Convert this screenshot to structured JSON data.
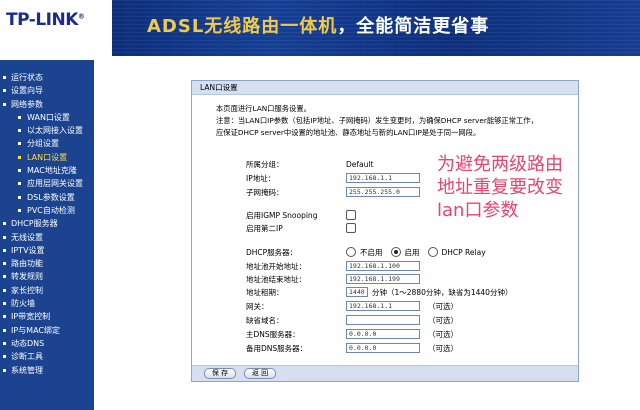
{
  "header": {
    "logo": "TP-LINK",
    "logo_mark": "®",
    "slogan_colored": "ADSL无线路由一体机",
    "slogan_white": "，全能简洁更省事"
  },
  "sidebar": {
    "items": [
      {
        "label": "运行状态",
        "level": 0,
        "active": false
      },
      {
        "label": "设置向导",
        "level": 0,
        "active": false
      },
      {
        "label": "网络参数",
        "level": 0,
        "active": false
      },
      {
        "label": "WAN口设置",
        "level": 1,
        "active": false
      },
      {
        "label": "以太网接入设置",
        "level": 1,
        "active": false
      },
      {
        "label": "分组设置",
        "level": 1,
        "active": false
      },
      {
        "label": "LAN口设置",
        "level": 1,
        "active": true
      },
      {
        "label": "MAC地址克隆",
        "level": 1,
        "active": false
      },
      {
        "label": "应用层网关设置",
        "level": 1,
        "active": false
      },
      {
        "label": "DSL参数设置",
        "level": 1,
        "active": false
      },
      {
        "label": "PVC自动检测",
        "level": 1,
        "active": false
      },
      {
        "label": "DHCP服务器",
        "level": 0,
        "active": false
      },
      {
        "label": "无线设置",
        "level": 0,
        "active": false
      },
      {
        "label": "IPTV设置",
        "level": 0,
        "active": false
      },
      {
        "label": "路由功能",
        "level": 0,
        "active": false
      },
      {
        "label": "转发规则",
        "level": 0,
        "active": false
      },
      {
        "label": "家长控制",
        "level": 0,
        "active": false
      },
      {
        "label": "防火墙",
        "level": 0,
        "active": false
      },
      {
        "label": "IP带宽控制",
        "level": 0,
        "active": false
      },
      {
        "label": "IP与MAC绑定",
        "level": 0,
        "active": false
      },
      {
        "label": "动态DNS",
        "level": 0,
        "active": false
      },
      {
        "label": "诊断工具",
        "level": 0,
        "active": false
      },
      {
        "label": "系统管理",
        "level": 0,
        "active": false
      }
    ]
  },
  "panel": {
    "title": "LAN口设置",
    "intro": "本页面进行LAN口服务设置。",
    "note_line1": "注意：当LAN口IP参数（包括IP地址、子网掩码）发生变更时，为确保DHCP server能够正常工作，",
    "note_line2": "应保证DHCP server中设置的地址池、静态地址与新的LAN口IP是处于同一网段。",
    "group_label": "所属分组：",
    "group_value": "Default",
    "ip_label": "IP地址：",
    "ip_value": "192.168.1.1",
    "mask_label": "子网掩码：",
    "mask_value": "255.255.255.0",
    "igmp_label": "启用IGMP Snooping",
    "second_ip_label": "启用第二IP",
    "dhcp_label": "DHCP服务器：",
    "dhcp_opt_off": "不启用",
    "dhcp_opt_on": "启用",
    "dhcp_opt_relay": "DHCP Relay",
    "dhcp_selected": "启用",
    "pool_start_label": "地址池开始地址：",
    "pool_start_value": "192.168.1.100",
    "pool_end_label": "地址池结束地址：",
    "pool_end_value": "192.168.1.199",
    "lease_label": "地址租期：",
    "lease_value": "1440",
    "lease_hint": "分钟（1～2880分钟，缺省为1440分钟）",
    "gateway_label": "网关：",
    "gateway_value": "192.168.1.1",
    "domain_label": "缺省域名：",
    "domain_value": "",
    "dns1_label": "主DNS服务器：",
    "dns1_value": "0.0.0.0",
    "dns2_label": "备用DNS服务器：",
    "dns2_value": "0.0.0.0",
    "optional": "（可选）",
    "save_label": "保 存",
    "back_label": "返 回"
  },
  "annotation": {
    "text": "为避免两级路由地址重复要改变lan口参数",
    "color": "#e8456f"
  },
  "colors": {
    "sidebar_bg": "#1b4390",
    "active_nav": "#ffdd33",
    "slogan_accent": "#f2ca4a"
  }
}
